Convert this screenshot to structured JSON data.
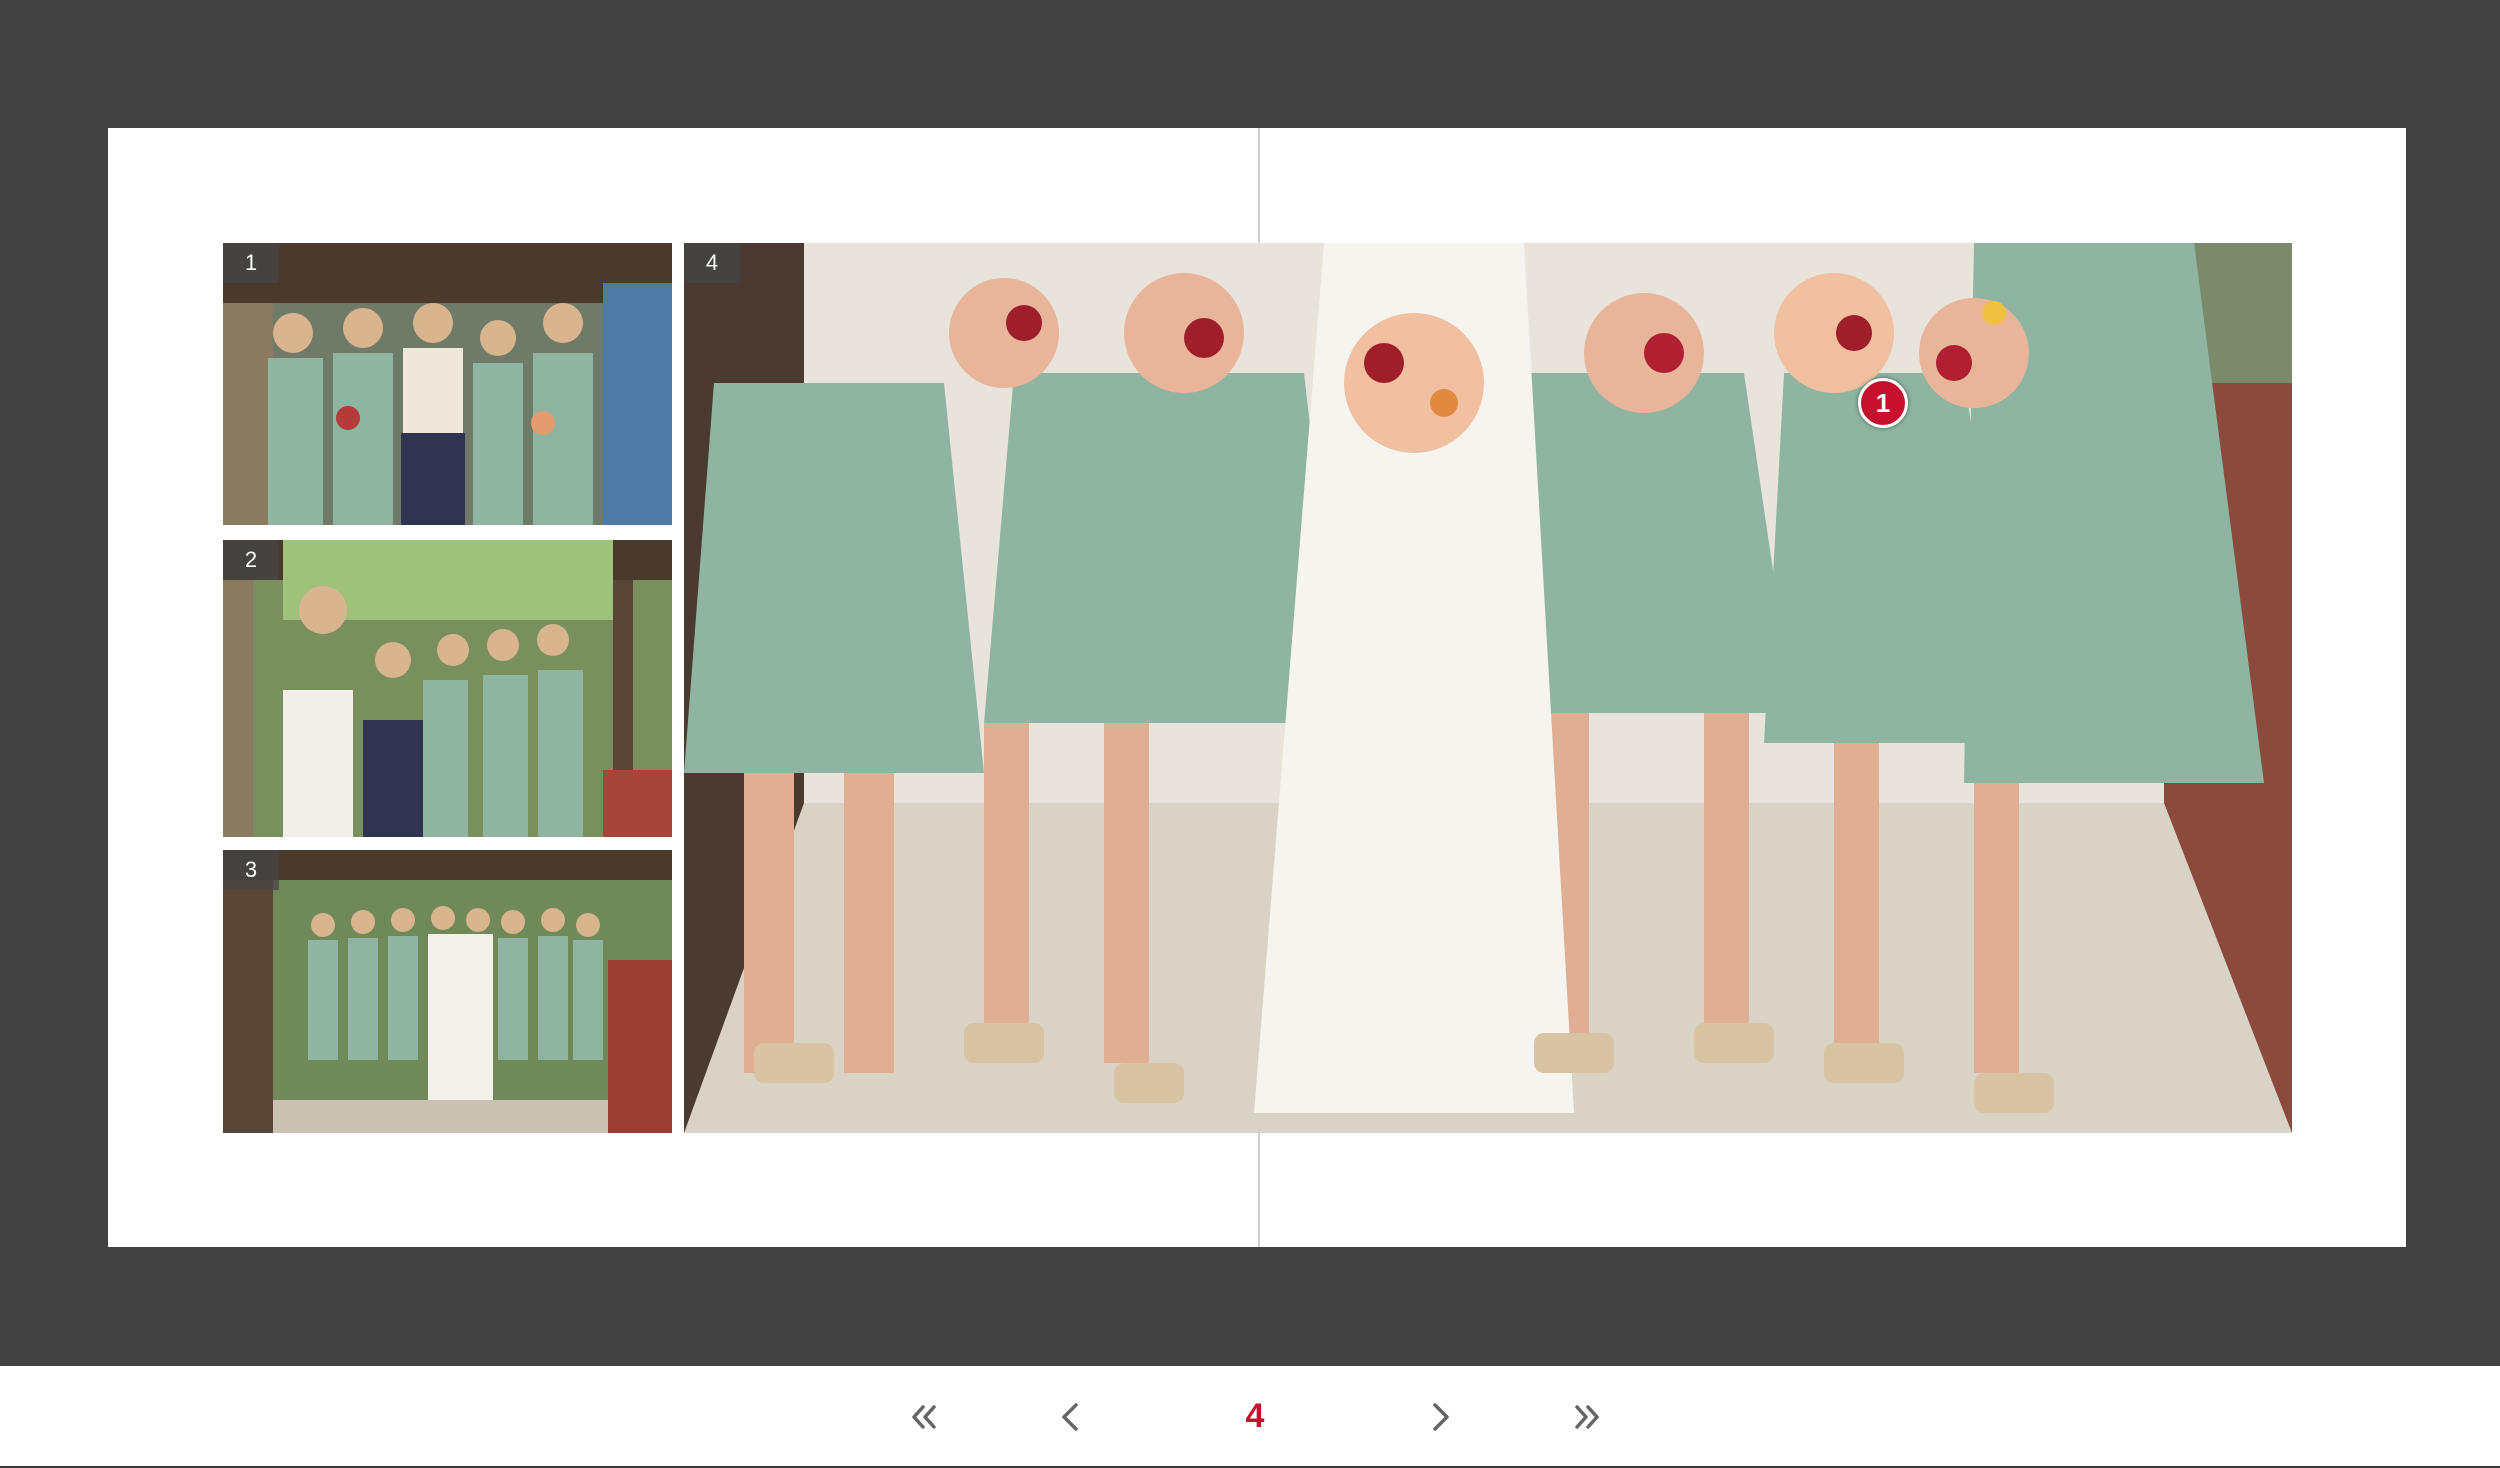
{
  "album": {
    "photos": [
      {
        "number": "1"
      },
      {
        "number": "2"
      },
      {
        "number": "3"
      },
      {
        "number": "4"
      }
    ],
    "annotation_marker": "1"
  },
  "navigation": {
    "current_page": "4",
    "icons": {
      "first": "double-chevron-left-icon",
      "prev": "chevron-left-icon",
      "next": "chevron-right-icon",
      "last": "double-chevron-right-icon"
    }
  },
  "colors": {
    "viewer_background": "#424242",
    "page": "#ffffff",
    "accent": "#c8102e",
    "dress": "#8fb5a2"
  }
}
